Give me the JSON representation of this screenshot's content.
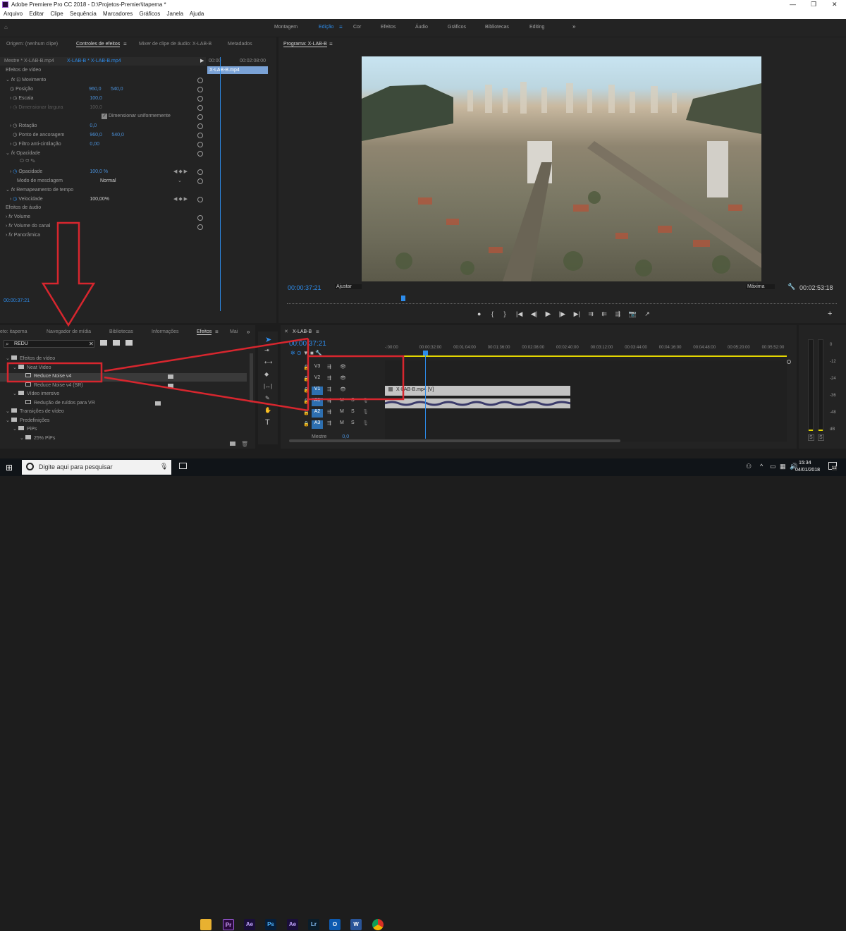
{
  "window": {
    "title": "Adobe Premiere Pro CC 2018 - D:\\Projetos-Premier\\itapema *",
    "controls": [
      "—",
      "❐",
      "✕"
    ]
  },
  "menu": [
    "Arquivo",
    "Editar",
    "Clipe",
    "Sequência",
    "Marcadores",
    "Gráficos",
    "Janela",
    "Ajuda"
  ],
  "workspaces": [
    "Montagem",
    "Edição",
    "Cor",
    "Efeitos",
    "Áudio",
    "Gráficos",
    "Bibliotecas",
    "Editing"
  ],
  "workspace_active": "Edição",
  "effect_controls": {
    "tabs": [
      "Origem: (nenhum clipe)",
      "Controles de efeitos",
      "Mixer de clipe de áudio: X-LAB-B",
      "Metadados"
    ],
    "master": "Mestre * X-LAB-B.mp4",
    "clip": "X-LAB-B * X-LAB-B.mp4",
    "tl_start": "00:00",
    "tl_end": "00:02:08:00",
    "clip_label": "X-LAB-B.mp4",
    "video_effects": "Efeitos de vídeo",
    "movimento": "Movimento",
    "posicao": {
      "label": "Posição",
      "x": "960,0",
      "y": "540,0"
    },
    "escala": {
      "label": "Escala",
      "value": "100,0"
    },
    "largura": {
      "label": "Dimensionar largura",
      "value": "100,0"
    },
    "uniforme": "Dimensionar uniformemente",
    "rotacao": {
      "label": "Rotação",
      "value": "0,0"
    },
    "ancoragem": {
      "label": "Ponto de ancoragem",
      "x": "960,0",
      "y": "540,0"
    },
    "filtro": {
      "label": "Filtro anti-cintilação",
      "value": "0,00"
    },
    "opacidade_group": "Opacidade",
    "opacidade": {
      "label": "Opacidade",
      "value": "100,0 %"
    },
    "mesclagem": {
      "label": "Modo de mesclagem",
      "value": "Normal"
    },
    "remap": "Remapeamento de tempo",
    "velocidade": {
      "label": "Velocidade",
      "value": "100,00%"
    },
    "audio_effects": "Efeitos de áudio",
    "volume": "Volume",
    "volume_canal": "Volume do canal",
    "panoramica": "Panorâmica",
    "timecode": "00:00:37:21"
  },
  "program": {
    "title": "Programa: X-LAB-B",
    "timecode": "00:00:37:21",
    "fit": "Ajustar",
    "quality": "Máxima",
    "duration": "00:02:53:18",
    "transport": [
      "●",
      "{",
      "}",
      "|◀",
      "◀|",
      "▶",
      "|▶",
      "▶|",
      "⇉",
      "⇇",
      "⇶",
      "📷",
      "↗"
    ]
  },
  "project": {
    "tabs": [
      "eto: itapema",
      "Navegador de mídia",
      "Bibliotecas",
      "Informações",
      "Efeitos",
      "Mai"
    ],
    "search_value": "REDU",
    "items": [
      {
        "label": "Efeitos de vídeo",
        "indent": 0,
        "kind": "folder"
      },
      {
        "label": "Neat Video",
        "indent": 1,
        "kind": "folder"
      },
      {
        "label": "Reduce Noise v4",
        "indent": 2,
        "kind": "fx",
        "selected": true
      },
      {
        "label": "Reduce Noise v4 (SR)",
        "indent": 2,
        "kind": "fx"
      },
      {
        "label": "Vídeo imersivo",
        "indent": 1,
        "kind": "folder"
      },
      {
        "label": "Redução de ruídos para VR",
        "indent": 2,
        "kind": "fx"
      },
      {
        "label": "Transições de vídeo",
        "indent": 0,
        "kind": "folder"
      },
      {
        "label": "Predefinições",
        "indent": 0,
        "kind": "folder"
      },
      {
        "label": "PiPs",
        "indent": 1,
        "kind": "folder"
      },
      {
        "label": "25% PiPs",
        "indent": 2,
        "kind": "folder"
      }
    ]
  },
  "timeline": {
    "title": "X-LAB-B",
    "timecode": "00:00:37:21",
    "ruler": [
      "-:00:00",
      "00:00:32:00",
      "00:01:04:00",
      "00:01:36:00",
      "00:02:08:00",
      "00:02:40:00",
      "00:03:12:00",
      "00:03:44:00",
      "00:04:16:00",
      "00:04:48:00",
      "00:05:20:00",
      "00:05:52:00"
    ],
    "tracks": [
      "V3",
      "V2",
      "V1",
      "A1",
      "A2",
      "A3"
    ],
    "master": "Mestre",
    "master_value": "0,0",
    "clip_label": "X-LAB-B.mp4 [V]",
    "meter": [
      "0",
      "-12",
      "-24",
      "-36",
      "-48",
      "dB"
    ],
    "meter_solo": [
      "S",
      "S"
    ]
  },
  "taskbar": {
    "search_placeholder": "Digite aqui para pesquisar",
    "time": "15:34",
    "date": "04/01/2018",
    "badge": "12"
  },
  "colors": {
    "annotation": "#d7262e",
    "accent": "#2d8ceb",
    "playhead": "#2d8ceb"
  }
}
